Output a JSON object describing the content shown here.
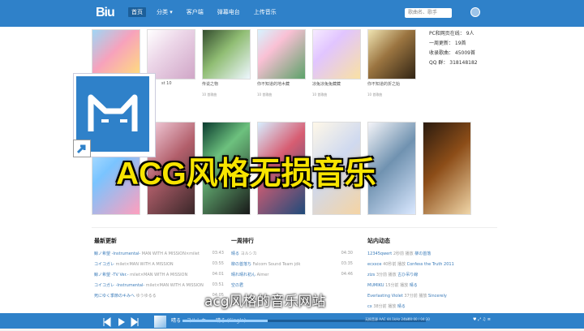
{
  "header": {
    "logo": "Biu",
    "nav": [
      "首页",
      "分类 ▾",
      "客户端",
      "弹幕电台",
      "上传音乐"
    ],
    "search_placeholder": "歌曲名、歌手"
  },
  "albums_row1": [
    {
      "title": "",
      "meta": ""
    },
    {
      "title": "st 10",
      "meta": ""
    },
    {
      "title": "传说之物",
      "meta": "10 首歌曲"
    },
    {
      "title": "你不知道的地木藏",
      "meta": "10 首歌曲"
    },
    {
      "title": "凉兔凉兔兔藏藏",
      "meta": "10 首歌曲"
    },
    {
      "title": "你不知道的折之始",
      "meta": "10 首歌曲"
    }
  ],
  "stats": {
    "online": "PC和网页在线： 9人",
    "weekly": "一周更新： 19首",
    "total": "收录歌曲： 45009首",
    "qq": "QQ 群： 318148182"
  },
  "sections": {
    "latest": "最新更新",
    "weekly": "一周排行",
    "dynamic": "站内动态"
  },
  "latest_rows": [
    {
      "song": "鲸ノ希望 -Instrumental-",
      "meta": "MAN WITH A MISSION×milet",
      "time": "03:43"
    },
    {
      "song": "コイコガレ",
      "meta": "milet×MAN WITH A MISSION",
      "time": "03:55"
    },
    {
      "song": "鲸ノ希望 -TV Ver.-",
      "meta": "milet×MAN WITH A MISSION",
      "time": "04:01"
    },
    {
      "song": "コイコガレ -Instrumental-",
      "meta": "milet×MAN WITH A MISSION",
      "time": "03:51"
    },
    {
      "song": "死にゆく季節のキみへ",
      "meta": "ゆうゆるる",
      "time": "04:05"
    }
  ],
  "weekly_rows": [
    {
      "song": "晴る",
      "meta": "ヨルシカ",
      "time": "04:30"
    },
    {
      "song": "柳の首落ち",
      "meta": "Falcom Sound Team jdk",
      "time": "03:35"
    },
    {
      "song": "晴れ晴れ初ん",
      "meta": "Aimer",
      "time": "04:46"
    },
    {
      "song": "空の君",
      "meta": "",
      "time": ""
    }
  ],
  "dynamic_rows": [
    {
      "user": "12345qwert",
      "action": "2秒前 播放",
      "song": "柳の首落"
    },
    {
      "user": "ecxxce",
      "action": "40秒前 播放",
      "song": "Confess the Truth 2011"
    },
    {
      "user": "zizs",
      "action": "3分前 播放",
      "song": "古ひ吊り線"
    },
    {
      "user": "MUMIKU",
      "action": "15分前 播放",
      "song": "晴る"
    },
    {
      "user": "Everlasting Violet",
      "action": "37分前 播放",
      "song": "Sincerely"
    },
    {
      "user": "cx",
      "action": "38分前 播放",
      "song": "晴る"
    }
  ],
  "overlay_title": "ACG风格无损音乐",
  "caption": "acg风格的音乐网站",
  "player": {
    "title": "晴る",
    "artist": "ヨルシカ",
    "album": "晴る (Single)",
    "quality": "无损音源 AAC 44.1kHz 24bit",
    "time": "00:00 / 04:30",
    "progress": 0.35
  }
}
